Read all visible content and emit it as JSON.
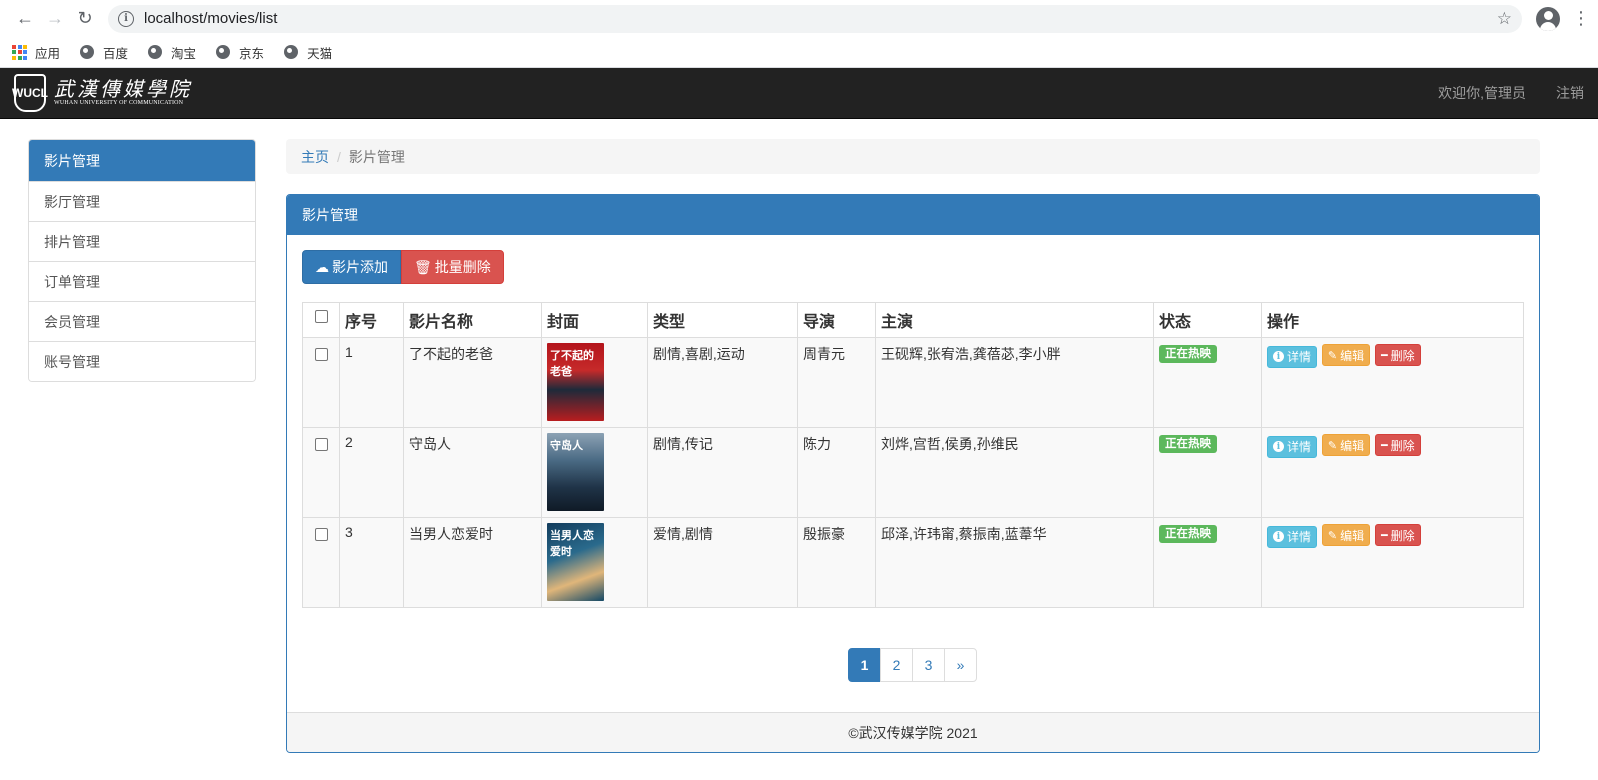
{
  "browser": {
    "url": "localhost/movies/list",
    "bookmarks": [
      {
        "label": "应用"
      },
      {
        "label": "百度"
      },
      {
        "label": "淘宝"
      },
      {
        "label": "京东"
      },
      {
        "label": "天猫"
      }
    ]
  },
  "navbar": {
    "logo_seal": "WUCL",
    "logo_cn": "武漢傳媒學院",
    "logo_en": "WUHAN UNIVERSITY OF COMMUNICATION",
    "welcome": "欢迎你,管理员",
    "logout": "注销"
  },
  "sidebar": {
    "items": [
      {
        "label": "影片管理"
      },
      {
        "label": "影厅管理"
      },
      {
        "label": "排片管理"
      },
      {
        "label": "订单管理"
      },
      {
        "label": "会员管理"
      },
      {
        "label": "账号管理"
      }
    ]
  },
  "breadcrumb": {
    "home": "主页",
    "separator": "/",
    "current": "影片管理"
  },
  "panel": {
    "title": "影片管理",
    "add_label": "影片添加",
    "batch_delete_label": "批量删除",
    "footer": "©武汉传媒学院 2021"
  },
  "table": {
    "headers": {
      "index": "序号",
      "name": "影片名称",
      "cover": "封面",
      "type": "类型",
      "director": "导演",
      "cast": "主演",
      "status": "状态",
      "actions": "操作"
    },
    "rows": [
      {
        "index": "1",
        "name": "了不起的老爸",
        "poster_text": "了不起的老爸",
        "type": "剧情,喜剧,运动",
        "director": "周青元",
        "cast": "王砚辉,张宥浩,龚蓓苾,李小胖",
        "status": "正在热映"
      },
      {
        "index": "2",
        "name": "守岛人",
        "poster_text": "守岛人",
        "type": "剧情,传记",
        "director": "陈力",
        "cast": "刘烨,宫哲,侯勇,孙维民",
        "status": "正在热映"
      },
      {
        "index": "3",
        "name": "当男人恋爱时",
        "poster_text": "当男人恋爱时",
        "type": "爱情,剧情",
        "director": "殷振豪",
        "cast": "邱泽,许玮甯,蔡振南,蓝葦华",
        "status": "正在热映"
      }
    ],
    "action_labels": {
      "detail": "详情",
      "edit": "编辑",
      "delete": "删除"
    }
  },
  "pagination": {
    "pages": [
      "1",
      "2",
      "3"
    ],
    "next": "»",
    "active": "1"
  }
}
